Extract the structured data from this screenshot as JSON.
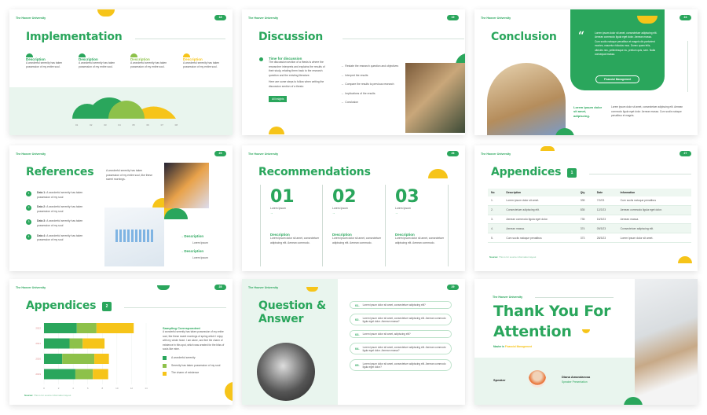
{
  "brand": {
    "university": "The Hoover University",
    "green": "#2aa65c",
    "light_green": "#8dc14a",
    "yellow": "#f6c419",
    "mint": "#e9f5ee"
  },
  "slides": [
    {
      "title": "Implementation",
      "number": "18",
      "columns": [
        {
          "heading": "Description",
          "text": "A wonderful serenity has taken possession of my entire soul."
        },
        {
          "heading": "Description",
          "text": "A wonderful serenity has taken possession of my entire soul."
        },
        {
          "heading": "Description",
          "text": "A wonderful serenity has taken possession of my entire soul."
        },
        {
          "heading": "Description",
          "text": "A wonderful serenity has taken possession of my entire soul."
        }
      ],
      "axis": [
        "01",
        "02",
        "03",
        "04",
        "05",
        "06",
        "07",
        "08"
      ]
    },
    {
      "title": "Discussion",
      "number": "19",
      "subtitle": "Time for discussion",
      "para1": "The discussion section of a thesis is where the researcher interprets and explains the results of their study, relating them back to the research question and the existing literature.",
      "para2": "Here are some steps to follow when writing the discussion section of a thesis:",
      "button": "All Insights",
      "steps": [
        "Restate the research question and objectives",
        "Interpret the results",
        "Compare the results to previous research",
        "Implications of the results",
        "Conclusion"
      ]
    },
    {
      "title": "Conclusion",
      "number": "24",
      "quote": "Lorem ipsum dolor sit amet, consectetuer adipiscing elit. Aenean commodo ligula eget dolor. Aenean massa. Cum sociis natoque penatibus et magnis dis parturient montes, nascetur ridiculus mus. Donec quam felis, ultricies nec, pellentesque eu, pretium quis, sem. Nulla consequat massa.",
      "button": "Financial Management",
      "lead": "Lorem ipsum dolor sit amet, adipiscing.",
      "text": "Lorem ipsum dolor sit amet, consectetuer adipiscing elit. Aenean commodo ligula eget dolor. Aenean massa. Cum sociis natoque penatibus et magnis."
    },
    {
      "title": "References",
      "number": "25",
      "intro": "A wonderful serenity has taken possession of my entire soul, like these sweet mornings.",
      "items": [
        {
          "n": "1",
          "label": "Data 1:",
          "text": "A wonderful serenity has taken possession of my soul"
        },
        {
          "n": "2",
          "label": "Data 2:",
          "text": "A wonderful serenity has taken possession of my soul"
        },
        {
          "n": "3",
          "label": "Data 3:",
          "text": "A wonderful serenity has taken possession of my soul"
        },
        {
          "n": "4",
          "label": "Data 4:",
          "text": "A wonderful serenity has taken possession of my soul"
        }
      ],
      "descs": [
        {
          "heading": "Description",
          "text": "Lorem Ipsum"
        },
        {
          "heading": "Description",
          "text": "Lorem Ipsum"
        }
      ]
    },
    {
      "title": "Recommendations",
      "number": "26",
      "cols": [
        {
          "big": "01",
          "sub": "Lorem Ipsum",
          "arrow": "→",
          "heading": "Description",
          "text": "Lorem ipsum dolor sit amet, consectetuer adipiscing elit. Aenean commodo."
        },
        {
          "big": "02",
          "sub": "Lorem Ipsum",
          "arrow": "→",
          "heading": "Description",
          "text": "Lorem ipsum dolor sit amet, consectetuer adipiscing elit. Aenean commodo."
        },
        {
          "big": "03",
          "sub": "Lorem Ipsum",
          "arrow": "→",
          "heading": "Description",
          "text": "Lorem ipsum dolor sit amet, consectetuer adipiscing elit. Aenean commodo."
        }
      ]
    },
    {
      "title": "Appendices",
      "badge": "1",
      "number": "27",
      "headers": [
        "No",
        "Description",
        "Qty",
        "Date",
        "Information"
      ],
      "rows": [
        [
          "1.",
          "Lorem ipsum dolor sit amet.",
          "335",
          "7/2/23",
          "Cum sociis natoque penatibus"
        ],
        [
          "2.",
          "Consectetuer adipiscing elit.",
          "835",
          "12/2/23",
          "Aenean commodo ligula eget dolor."
        ],
        [
          "3.",
          "Aenean commodo ligula eget dolor.",
          "735",
          "16/3/23",
          "Aenean massa."
        ],
        [
          "4.",
          "Aenean massa.",
          "374",
          "09/3/23",
          "Consectetuer adipiscing elit."
        ],
        [
          "5.",
          "Cum sociis natoque penatibus",
          "373",
          "28/3/23",
          "Lorem ipsum dolor sit amet."
        ]
      ],
      "source_label": "Source:",
      "source_text": "This is for source information layout"
    },
    {
      "title": "Appendices",
      "badge": "2",
      "number": "28",
      "heading": "Sampling Correspondent",
      "text": "A wonderful serenity has taken possession of my entire soul, like these sweet mornings of spring which I enjoy with my whole heart. I am alone, and feel the charm of existence in this spot, which was created for the bliss of souls like mine.",
      "legend": [
        "A wonderful serenity",
        "Serenity has taken possession of my soul",
        "The charm of existence"
      ],
      "source_label": "Source:",
      "source_text": "This is for source information layout"
    },
    {
      "title": "Question & Answer",
      "number": "29",
      "questions": [
        {
          "n": "01.",
          "text": "Lorem ipsum dolor sit amet, consectetuer adipiscing elit?"
        },
        {
          "n": "02.",
          "text": "Lorem ipsum dolor sit amet, consectetuer adipiscing elit. Aenean commodo ligula eget dolor. Aenean massa?"
        },
        {
          "n": "03.",
          "text": "Lorem ipsum dolor sit amet, adipiscing elit?"
        },
        {
          "n": "04.",
          "text": "Lorem ipsum dolor sit amet, consectetuer adipiscing elit. Aenean commodo ligula eget dolor. Aenean massa?"
        },
        {
          "n": "05.",
          "text": "Lorem ipsum dolor sit amet, consectetuer adipiscing elit. Aenean commodo ligula eget dolor?"
        }
      ]
    },
    {
      "title": "Thank You For Attention",
      "subtitle_prefix": "Master in",
      "subtitle_highlight": "Financial Management",
      "speaker_label": "Speaker",
      "speaker_name": "Diana Amandarosa",
      "speaker_role": "Speaker Presentation"
    }
  ],
  "chart_data": {
    "type": "bar",
    "orientation": "horizontal",
    "stacked": true,
    "categories": [
      "2022",
      "2021",
      "2020",
      "2019"
    ],
    "series": [
      {
        "name": "A wonderful serenity",
        "values": [
          4.5,
          3.5,
          2.5,
          4.3
        ],
        "color": "#2aa65c"
      },
      {
        "name": "Serenity has taken possession of my soul",
        "values": [
          2.7,
          1.8,
          4.4,
          2.4
        ],
        "color": "#8dc14a"
      },
      {
        "name": "The charm of existence",
        "values": [
          5.1,
          3.0,
          2.0,
          2.1
        ],
        "color": "#f6c419"
      }
    ],
    "xticks": [
      "0",
      "2",
      "4",
      "6",
      "8",
      "10",
      "12",
      "14"
    ],
    "xlim": [
      0,
      14
    ],
    "grid": true,
    "legend": "right"
  }
}
